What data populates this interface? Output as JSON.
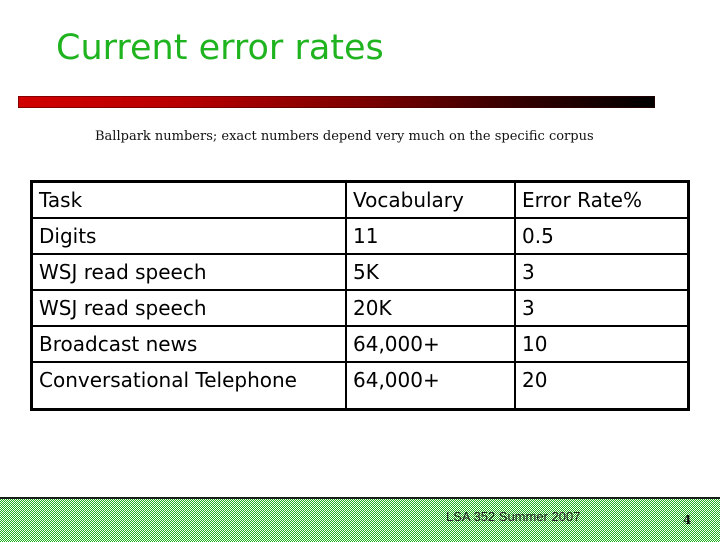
{
  "slide": {
    "title": "Current error rates",
    "subtitle": "Ballpark numbers; exact numbers depend very much on the specific corpus"
  },
  "table": {
    "headers": [
      "Task",
      "Vocabulary",
      "Error Rate%"
    ],
    "rows": [
      [
        "Digits",
        "11",
        "0.5"
      ],
      [
        "WSJ read speech",
        "5K",
        "3"
      ],
      [
        "WSJ read speech",
        "20K",
        "3"
      ],
      [
        "Broadcast news",
        "64,000+",
        "10"
      ],
      [
        "Conversational Telephone",
        "64,000+",
        "20"
      ]
    ]
  },
  "footer": {
    "course": "LSA 352 Summer 2007",
    "page_number": "4"
  },
  "colors": {
    "title": "#1fb41f",
    "rule_start": "#d10000",
    "rule_end": "#000000",
    "footer_green": "#22b022"
  }
}
